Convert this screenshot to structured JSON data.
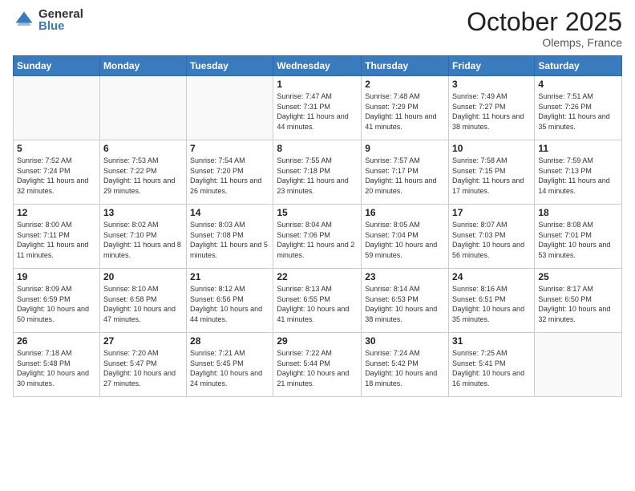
{
  "logo": {
    "general": "General",
    "blue": "Blue"
  },
  "header": {
    "month": "October 2025",
    "location": "Olemps, France"
  },
  "weekdays": [
    "Sunday",
    "Monday",
    "Tuesday",
    "Wednesday",
    "Thursday",
    "Friday",
    "Saturday"
  ],
  "weeks": [
    [
      {
        "day": "",
        "info": ""
      },
      {
        "day": "",
        "info": ""
      },
      {
        "day": "",
        "info": ""
      },
      {
        "day": "1",
        "info": "Sunrise: 7:47 AM\nSunset: 7:31 PM\nDaylight: 11 hours and 44 minutes."
      },
      {
        "day": "2",
        "info": "Sunrise: 7:48 AM\nSunset: 7:29 PM\nDaylight: 11 hours and 41 minutes."
      },
      {
        "day": "3",
        "info": "Sunrise: 7:49 AM\nSunset: 7:27 PM\nDaylight: 11 hours and 38 minutes."
      },
      {
        "day": "4",
        "info": "Sunrise: 7:51 AM\nSunset: 7:26 PM\nDaylight: 11 hours and 35 minutes."
      }
    ],
    [
      {
        "day": "5",
        "info": "Sunrise: 7:52 AM\nSunset: 7:24 PM\nDaylight: 11 hours and 32 minutes."
      },
      {
        "day": "6",
        "info": "Sunrise: 7:53 AM\nSunset: 7:22 PM\nDaylight: 11 hours and 29 minutes."
      },
      {
        "day": "7",
        "info": "Sunrise: 7:54 AM\nSunset: 7:20 PM\nDaylight: 11 hours and 26 minutes."
      },
      {
        "day": "8",
        "info": "Sunrise: 7:55 AM\nSunset: 7:18 PM\nDaylight: 11 hours and 23 minutes."
      },
      {
        "day": "9",
        "info": "Sunrise: 7:57 AM\nSunset: 7:17 PM\nDaylight: 11 hours and 20 minutes."
      },
      {
        "day": "10",
        "info": "Sunrise: 7:58 AM\nSunset: 7:15 PM\nDaylight: 11 hours and 17 minutes."
      },
      {
        "day": "11",
        "info": "Sunrise: 7:59 AM\nSunset: 7:13 PM\nDaylight: 11 hours and 14 minutes."
      }
    ],
    [
      {
        "day": "12",
        "info": "Sunrise: 8:00 AM\nSunset: 7:11 PM\nDaylight: 11 hours and 11 minutes."
      },
      {
        "day": "13",
        "info": "Sunrise: 8:02 AM\nSunset: 7:10 PM\nDaylight: 11 hours and 8 minutes."
      },
      {
        "day": "14",
        "info": "Sunrise: 8:03 AM\nSunset: 7:08 PM\nDaylight: 11 hours and 5 minutes."
      },
      {
        "day": "15",
        "info": "Sunrise: 8:04 AM\nSunset: 7:06 PM\nDaylight: 11 hours and 2 minutes."
      },
      {
        "day": "16",
        "info": "Sunrise: 8:05 AM\nSunset: 7:04 PM\nDaylight: 10 hours and 59 minutes."
      },
      {
        "day": "17",
        "info": "Sunrise: 8:07 AM\nSunset: 7:03 PM\nDaylight: 10 hours and 56 minutes."
      },
      {
        "day": "18",
        "info": "Sunrise: 8:08 AM\nSunset: 7:01 PM\nDaylight: 10 hours and 53 minutes."
      }
    ],
    [
      {
        "day": "19",
        "info": "Sunrise: 8:09 AM\nSunset: 6:59 PM\nDaylight: 10 hours and 50 minutes."
      },
      {
        "day": "20",
        "info": "Sunrise: 8:10 AM\nSunset: 6:58 PM\nDaylight: 10 hours and 47 minutes."
      },
      {
        "day": "21",
        "info": "Sunrise: 8:12 AM\nSunset: 6:56 PM\nDaylight: 10 hours and 44 minutes."
      },
      {
        "day": "22",
        "info": "Sunrise: 8:13 AM\nSunset: 6:55 PM\nDaylight: 10 hours and 41 minutes."
      },
      {
        "day": "23",
        "info": "Sunrise: 8:14 AM\nSunset: 6:53 PM\nDaylight: 10 hours and 38 minutes."
      },
      {
        "day": "24",
        "info": "Sunrise: 8:16 AM\nSunset: 6:51 PM\nDaylight: 10 hours and 35 minutes."
      },
      {
        "day": "25",
        "info": "Sunrise: 8:17 AM\nSunset: 6:50 PM\nDaylight: 10 hours and 32 minutes."
      }
    ],
    [
      {
        "day": "26",
        "info": "Sunrise: 7:18 AM\nSunset: 5:48 PM\nDaylight: 10 hours and 30 minutes."
      },
      {
        "day": "27",
        "info": "Sunrise: 7:20 AM\nSunset: 5:47 PM\nDaylight: 10 hours and 27 minutes."
      },
      {
        "day": "28",
        "info": "Sunrise: 7:21 AM\nSunset: 5:45 PM\nDaylight: 10 hours and 24 minutes."
      },
      {
        "day": "29",
        "info": "Sunrise: 7:22 AM\nSunset: 5:44 PM\nDaylight: 10 hours and 21 minutes."
      },
      {
        "day": "30",
        "info": "Sunrise: 7:24 AM\nSunset: 5:42 PM\nDaylight: 10 hours and 18 minutes."
      },
      {
        "day": "31",
        "info": "Sunrise: 7:25 AM\nSunset: 5:41 PM\nDaylight: 10 hours and 16 minutes."
      },
      {
        "day": "",
        "info": ""
      }
    ]
  ]
}
